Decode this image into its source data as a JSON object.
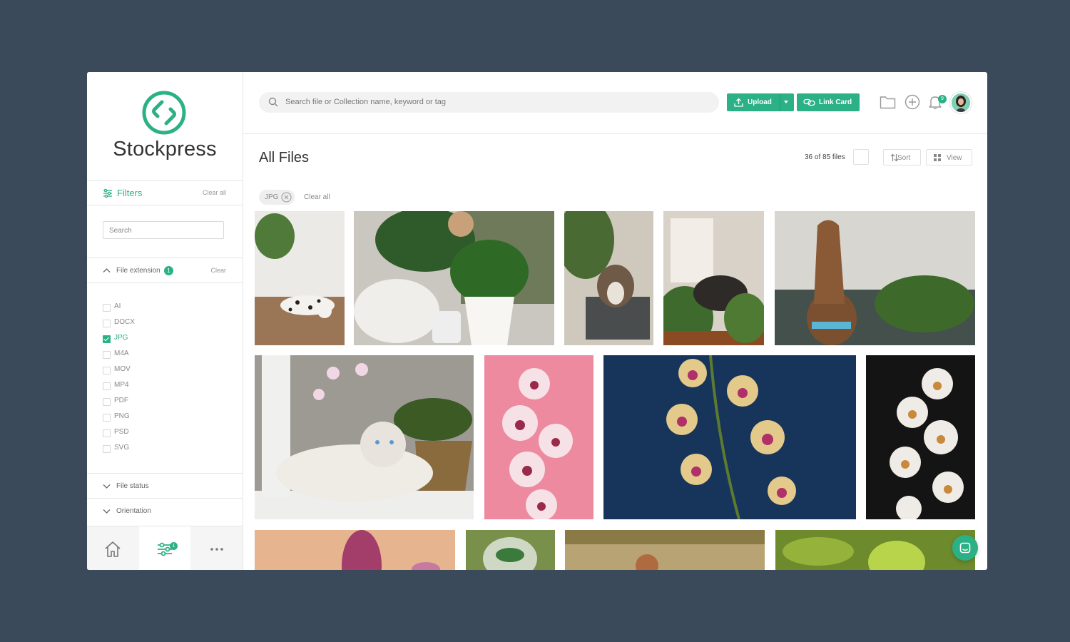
{
  "brand": {
    "name": "Stockpress",
    "color": "#2bb185"
  },
  "sidebar": {
    "filters_label": "Filters",
    "filters_clear": "Clear all",
    "search_placeholder": "Search",
    "sections": {
      "file_extension": {
        "label": "File extension",
        "badge": "1",
        "clear": "Clear",
        "expanded": true
      },
      "file_status": {
        "label": "File status",
        "expanded": false
      },
      "orientation": {
        "label": "Orientation",
        "expanded": false
      }
    },
    "extensions": [
      {
        "label": "AI",
        "checked": false
      },
      {
        "label": "DOCX",
        "checked": false
      },
      {
        "label": "JPG",
        "checked": true
      },
      {
        "label": "M4A",
        "checked": false
      },
      {
        "label": "MOV",
        "checked": false
      },
      {
        "label": "MP4",
        "checked": false
      },
      {
        "label": "PDF",
        "checked": false
      },
      {
        "label": "PNG",
        "checked": false
      },
      {
        "label": "PSD",
        "checked": false
      },
      {
        "label": "SVG",
        "checked": false
      }
    ],
    "bottom_nav": {
      "filters_badge": "1",
      "items": [
        "home-icon",
        "filters-icon",
        "more-icon"
      ]
    }
  },
  "topbar": {
    "search_placeholder": "Search file or Collection name, keyword or tag",
    "upload_label": "Upload",
    "link_card_label": "Link Card",
    "notifications_count": "9"
  },
  "main": {
    "title": "All Files",
    "count": "36 of 85 files",
    "sort_label": "Sort",
    "view_label": "View",
    "active_chip": "JPG",
    "chips_clear": "Clear all"
  },
  "images": [
    {
      "subject": "dalmatian lying on wooden floor"
    },
    {
      "subject": "person with dog and houseplants"
    },
    {
      "subject": "dog sitting in chair"
    },
    {
      "subject": "dog on couch by window"
    },
    {
      "subject": "brown dog looking up"
    },
    {
      "subject": "white fluffy cat with orchid"
    },
    {
      "subject": "pink orchids on pink background"
    },
    {
      "subject": "orchids on dark blue background"
    },
    {
      "subject": "white orchids on black background"
    },
    {
      "subject": "pink flower close-up"
    },
    {
      "subject": "plant in glass jar"
    },
    {
      "subject": "person outdoors"
    },
    {
      "subject": "green leaves"
    }
  ]
}
